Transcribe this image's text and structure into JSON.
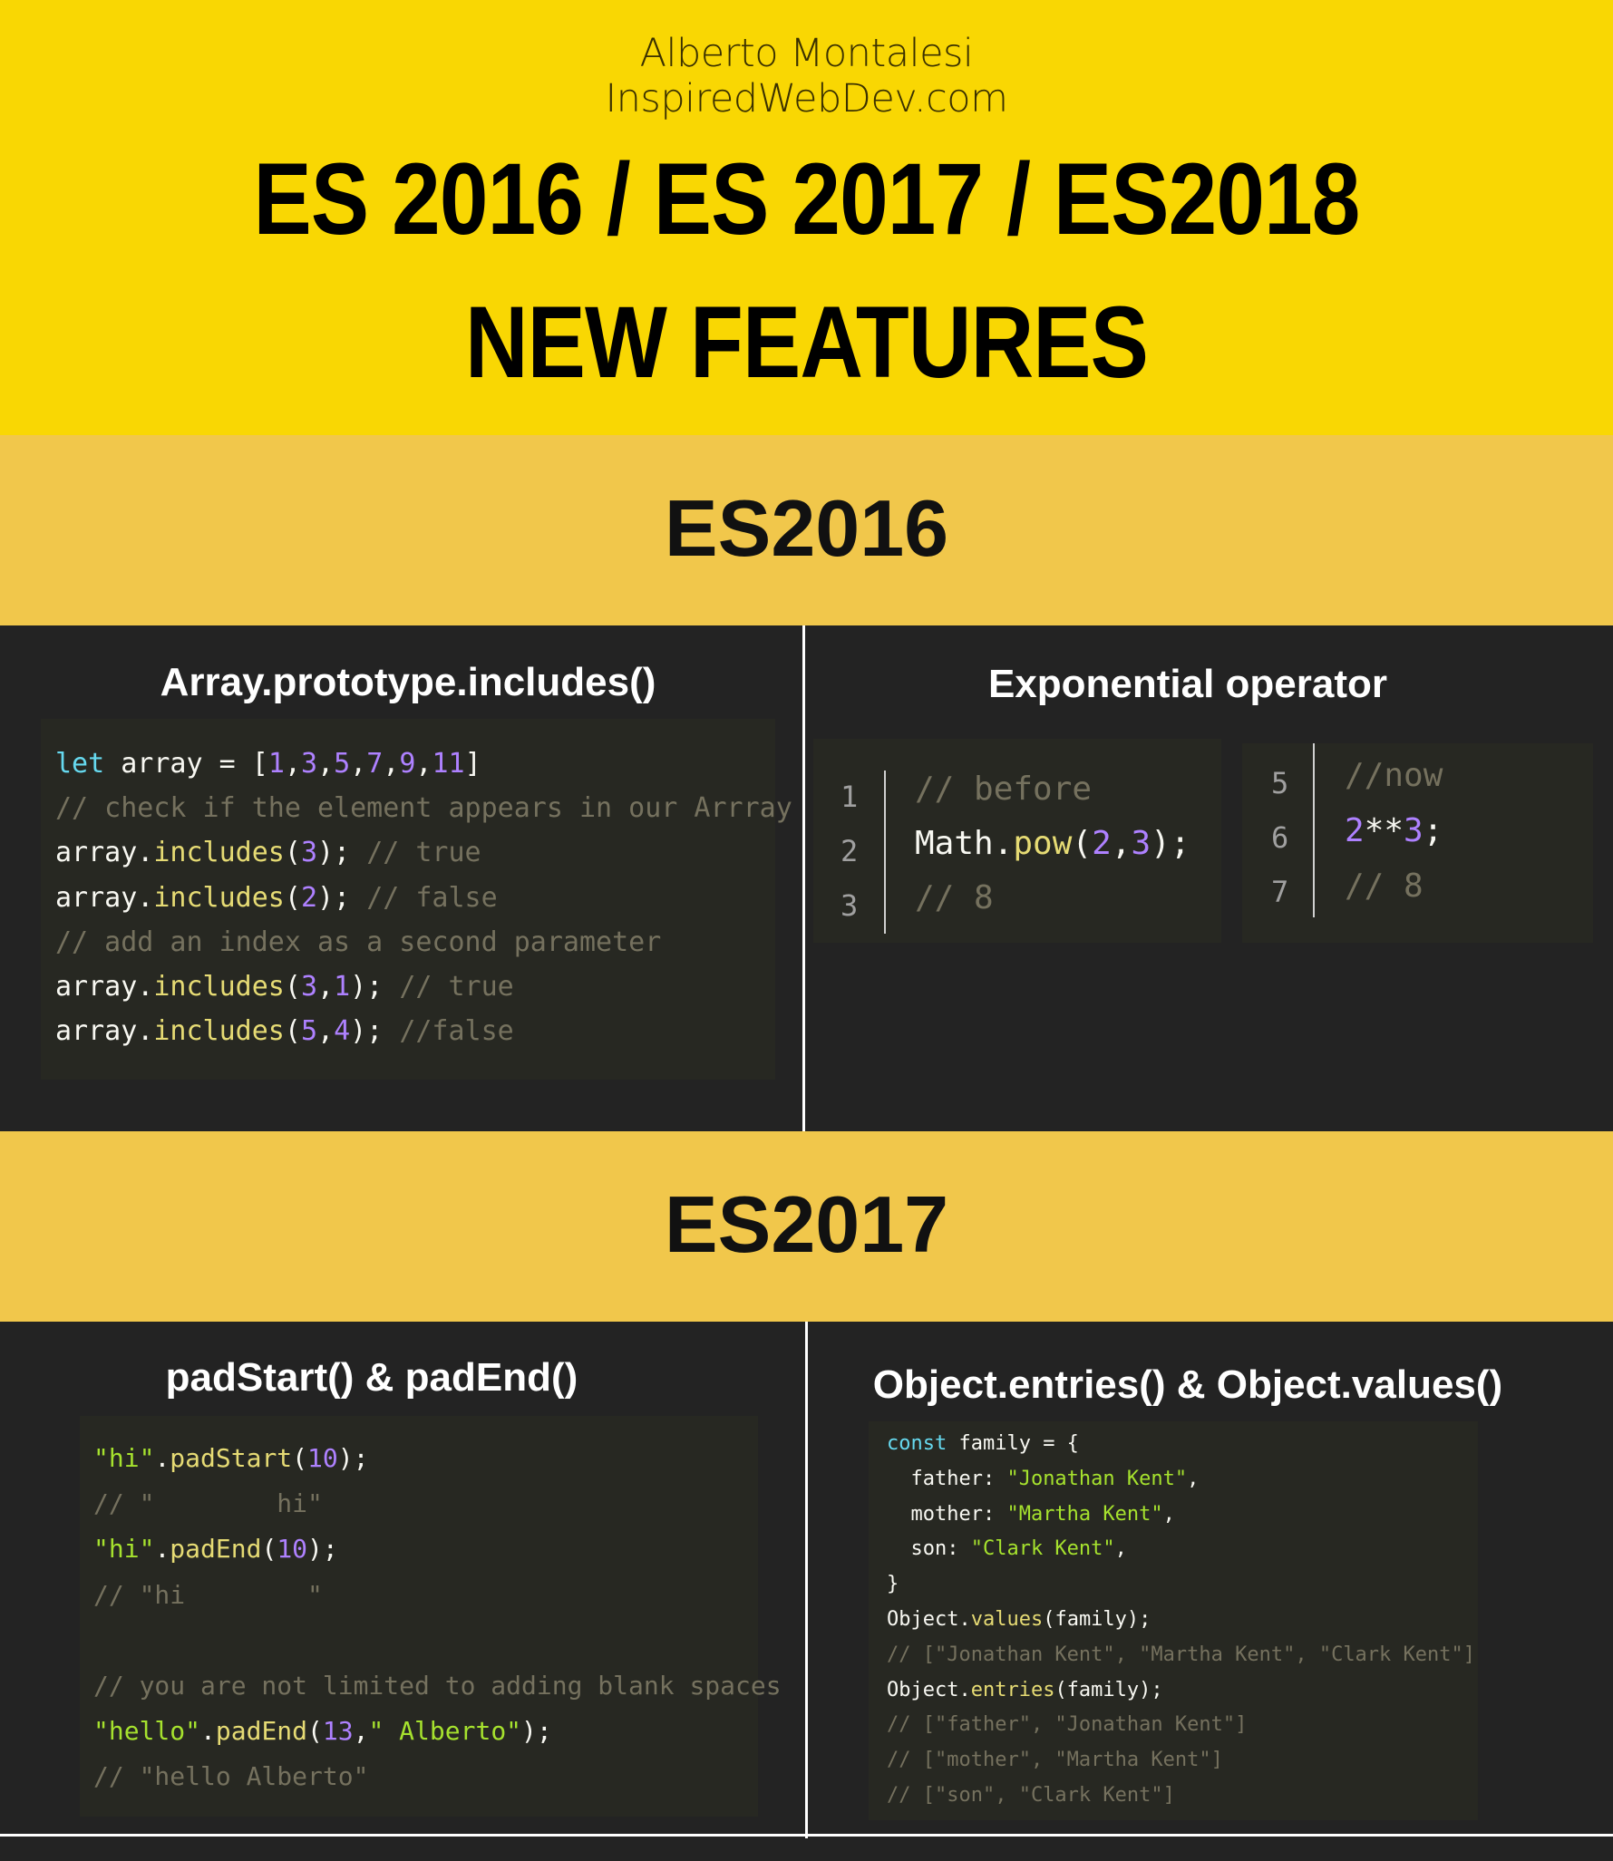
{
  "header": {
    "author": "Alberto Montalesi",
    "site": "InspiredWebDev.com",
    "title_line1": "ES 2016 / ES 2017 / ES2018",
    "title_line2": "NEW FEATURES"
  },
  "colors": {
    "header_bg": "#f9d703",
    "band_bg": "#f1c74b",
    "panel_bg": "#232323",
    "code_bg": "#272822",
    "keyword": "#66d9ef",
    "number": "#ae81ff",
    "comment": "#75715e",
    "string": "#a6e22e"
  },
  "es2016": {
    "heading": "ES2016",
    "includes": {
      "title": "Array.prototype.includes()",
      "lines": [
        "let array = [1,3,5,7,9,11]",
        "// check if the element appears in our Arrray",
        "array.includes(3); // true",
        "array.includes(2); // false",
        "// add an index as a second parameter",
        "array.includes(3,1); // true",
        "array.includes(5,4); //false"
      ]
    },
    "exponential": {
      "title": "Exponential operator",
      "before": {
        "line_numbers": [
          "1",
          "2",
          "3"
        ],
        "lines": [
          "// before",
          "Math.pow(2,3);",
          "// 8"
        ]
      },
      "now": {
        "line_numbers": [
          "5",
          "6",
          "7"
        ],
        "lines": [
          "//now",
          "2**3;",
          "// 8"
        ]
      }
    }
  },
  "es2017": {
    "heading": "ES2017",
    "pad": {
      "title": "padStart() & padEnd()",
      "lines": [
        "\"hi\".padStart(10);",
        "// \"        hi\"",
        "\"hi\".padEnd(10);",
        "// \"hi        \"",
        "",
        "// you are not limited to adding blank spaces",
        "\"hello\".padEnd(13,\" Alberto\");",
        "// \"hello Alberto\""
      ]
    },
    "object": {
      "title": "Object.entries() & Object.values()",
      "lines": [
        "const family = {",
        "  father: \"Jonathan Kent\",",
        "  mother: \"Martha Kent\",",
        "  son: \"Clark Kent\",",
        "}",
        "Object.values(family);",
        "// [\"Jonathan Kent\", \"Martha Kent\", \"Clark Kent\"]",
        "Object.entries(family);",
        "// [\"father\", \"Jonathan Kent\"]",
        "// [\"mother\", \"Martha Kent\"]",
        "// [\"son\", \"Clark Kent\"]"
      ]
    }
  }
}
